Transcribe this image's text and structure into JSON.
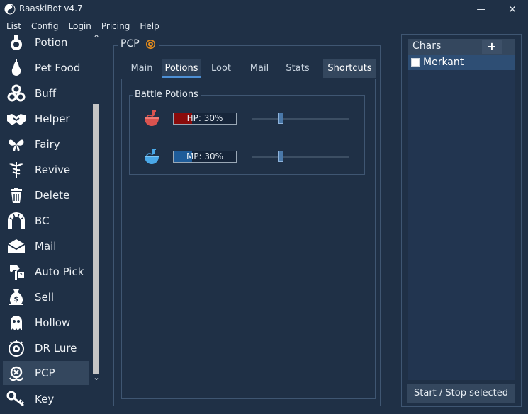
{
  "window": {
    "title": "RaaskiBot v4.7",
    "minimize_glyph": "—",
    "close_glyph": "✕"
  },
  "menu": [
    "List",
    "Config",
    "Login",
    "Pricing",
    "Help"
  ],
  "sidebar": {
    "items": [
      {
        "label": "Potion",
        "icon": "potion-flask-icon"
      },
      {
        "label": "Pet Food",
        "icon": "pear-icon"
      },
      {
        "label": "Buff",
        "icon": "triskelion-icon"
      },
      {
        "label": "Helper",
        "icon": "handshake-icon"
      },
      {
        "label": "Fairy",
        "icon": "fairy-icon"
      },
      {
        "label": "Revive",
        "icon": "caduceus-icon"
      },
      {
        "label": "Delete",
        "icon": "trash-icon"
      },
      {
        "label": "BC",
        "icon": "stone-arch-icon"
      },
      {
        "label": "Mail",
        "icon": "envelope-icon"
      },
      {
        "label": "Auto Pick",
        "icon": "claw-grab-icon"
      },
      {
        "label": "Sell",
        "icon": "money-bag-icon"
      },
      {
        "label": "Hollow",
        "icon": "ghost-icon"
      },
      {
        "label": "DR Lure",
        "icon": "lure-eye-icon"
      },
      {
        "label": "PCP",
        "icon": "pcp-emblem-icon"
      },
      {
        "label": "Key",
        "icon": "key-icon"
      }
    ],
    "active_index": 13,
    "scroll_up": "⌃",
    "scroll_down": "⌄"
  },
  "pcp": {
    "title": "PCP",
    "tabs": [
      "Main",
      "Potions",
      "Loot",
      "Mail",
      "Stats",
      "Shortcuts"
    ],
    "active_tab": "Potions",
    "battle_potions": {
      "title": "Battle Potions",
      "hp": {
        "text": "HP: 30%",
        "percent": 30,
        "color": "#8a0b0b",
        "icon_color": "#d9534f"
      },
      "mp": {
        "text": "MP: 30%",
        "percent": 30,
        "color": "#1f5c99",
        "icon_color": "#4aa8e8"
      }
    }
  },
  "chars": {
    "title": "Chars",
    "add_label": "+",
    "list": [
      {
        "name": "Merkant",
        "checked": false
      }
    ],
    "start_stop_label": "Start / Stop selected"
  },
  "colors": {
    "background": "#1f3046",
    "accent_tab": "#4d8fd4",
    "selected_row": "#2e4e74"
  }
}
